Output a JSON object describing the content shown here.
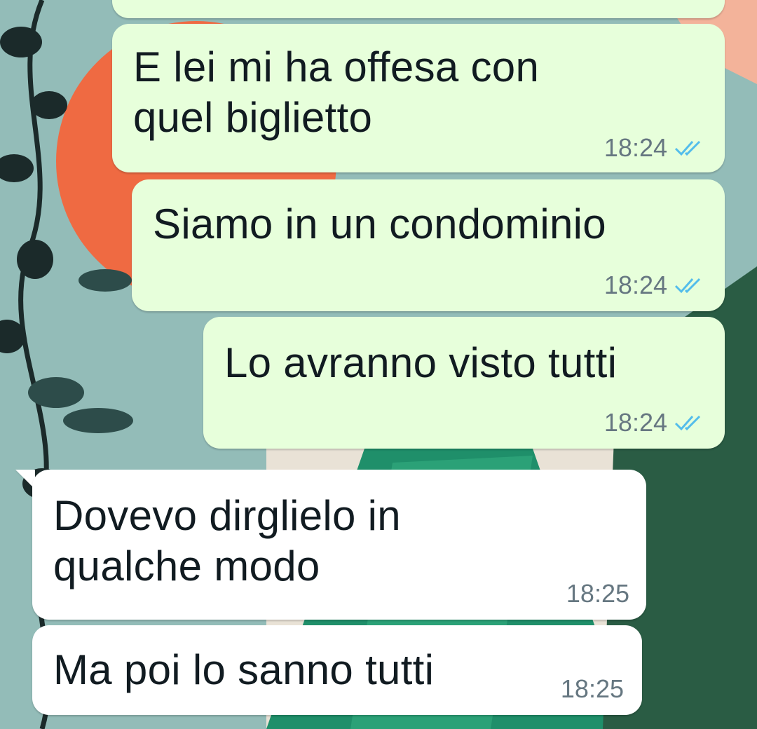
{
  "colors": {
    "outgoing_bubble": "#e7ffdb",
    "incoming_bubble": "#ffffff",
    "text": "#111b21",
    "timestamp": "#667781",
    "read_ticks": "#53bdeb"
  },
  "messages": [
    {
      "direction": "outgoing",
      "text": "",
      "time": "",
      "status": "read"
    },
    {
      "direction": "outgoing",
      "text": "E lei mi ha offesa con\nquel biglietto",
      "time": "18:24",
      "status": "read"
    },
    {
      "direction": "outgoing",
      "text": "Siamo in un condominio",
      "time": "18:24",
      "status": "read"
    },
    {
      "direction": "outgoing",
      "text": "Lo avranno visto tutti",
      "time": "18:24",
      "status": "read"
    },
    {
      "direction": "incoming",
      "text": "Dovevo dirglielo in\nqualche modo",
      "time": "18:25"
    },
    {
      "direction": "incoming",
      "text": "Ma poi lo sanno tutti",
      "time": "18:25"
    }
  ]
}
